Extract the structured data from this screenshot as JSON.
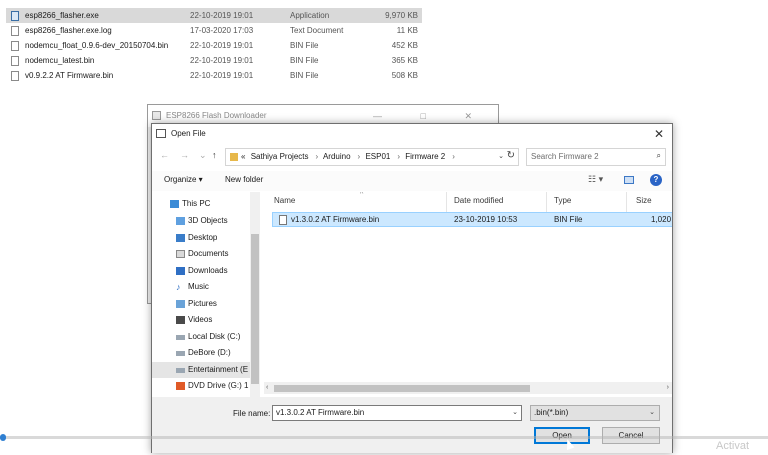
{
  "background_files": [
    {
      "name": "esp8266_flasher.exe",
      "date": "22-10-2019 19:01",
      "type": "Application",
      "size": "9,970 KB",
      "selected": true,
      "icon": "app-icon"
    },
    {
      "name": "esp8266_flasher.exe.log",
      "date": "17-03-2020 17:03",
      "type": "Text Document",
      "size": "11 KB",
      "selected": false,
      "icon": "text-file-icon"
    },
    {
      "name": "nodemcu_float_0.9.6-dev_20150704.bin",
      "date": "22-10-2019 19:01",
      "type": "BIN File",
      "size": "452 KB",
      "selected": false,
      "icon": "file-icon"
    },
    {
      "name": "nodemcu_latest.bin",
      "date": "22-10-2019 19:01",
      "type": "BIN File",
      "size": "365 KB",
      "selected": false,
      "icon": "file-icon"
    },
    {
      "name": "v0.9.2.2 AT Firmware.bin",
      "date": "22-10-2019 19:01",
      "type": "BIN File",
      "size": "508 KB",
      "selected": false,
      "icon": "file-icon"
    }
  ],
  "flasher_window": {
    "title": "ESP8266 Flash Downloader",
    "controls": "— □ ✕"
  },
  "dialog": {
    "title": "Open File",
    "close": "✕",
    "nav": {
      "back": "←",
      "forward": "→",
      "recent": "⌄",
      "up": "↑"
    },
    "breadcrumb": {
      "prefix": "«",
      "parts": [
        "Sathiya Projects",
        "Arduino",
        "ESP01",
        "Firmware 2"
      ]
    },
    "search_placeholder": "Search Firmware 2",
    "toolbar": {
      "organize": "Organize ▾",
      "new_folder": "New folder",
      "views": "☷ ▾"
    },
    "sidebar": [
      {
        "label": "This PC",
        "icon": "pc-icon",
        "active": false
      },
      {
        "label": "3D Objects",
        "icon": "cube-icon",
        "active": false
      },
      {
        "label": "Desktop",
        "icon": "desktop-icon",
        "active": false
      },
      {
        "label": "Documents",
        "icon": "documents-icon",
        "active": false
      },
      {
        "label": "Downloads",
        "icon": "downloads-icon",
        "active": false
      },
      {
        "label": "Music",
        "icon": "music-icon",
        "active": false
      },
      {
        "label": "Pictures",
        "icon": "pictures-icon",
        "active": false
      },
      {
        "label": "Videos",
        "icon": "videos-icon",
        "active": false
      },
      {
        "label": "Local Disk (C:)",
        "icon": "drive-icon",
        "active": false
      },
      {
        "label": "DeBore (D:)",
        "icon": "drive-icon",
        "active": false
      },
      {
        "label": "Entertainment (E",
        "icon": "drive-icon",
        "active": true
      },
      {
        "label": "DVD Drive (G:) 1",
        "icon": "dvd-icon",
        "active": false
      }
    ],
    "columns": {
      "name": "Name",
      "date": "Date modified",
      "type": "Type",
      "size": "Size"
    },
    "files": [
      {
        "name": "v1.3.0.2 AT Firmware.bin",
        "date": "23-10-2019 10:53",
        "type": "BIN File",
        "size": "1,020"
      }
    ],
    "footer": {
      "file_name_label": "File name:",
      "file_name_value": "v1.3.0.2 AT Firmware.bin",
      "filter_value": ".bin(*.bin)",
      "open_label": "Open",
      "cancel_label": "Cancel"
    }
  },
  "watermark": "Activat"
}
